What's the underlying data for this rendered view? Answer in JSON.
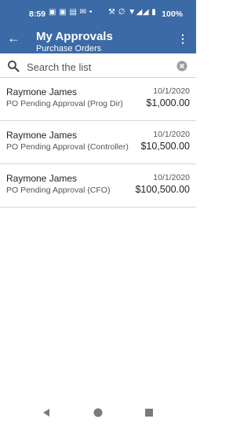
{
  "status_bar": {
    "time": "8:59",
    "battery": "100%",
    "notification_icons": "▣ ▣ ▤ ✉ •",
    "system_icons": "⚒ ∅ ▼◢◢ ▮"
  },
  "app_bar": {
    "title": "My Approvals",
    "subtitle": "Purchase Orders",
    "back_icon": "←",
    "more_icon": "⋮"
  },
  "search": {
    "placeholder": "Search the list",
    "value": ""
  },
  "list": {
    "items": [
      {
        "name": "Raymone James",
        "description": "PO Pending Approval (Prog Dir)",
        "date": "10/1/2020",
        "amount": "$1,000.00"
      },
      {
        "name": "Raymone James",
        "description": "PO Pending Approval (Controller)",
        "date": "10/1/2020",
        "amount": "$10,500.00"
      },
      {
        "name": "Raymone James",
        "description": "PO Pending Approval (CFO)",
        "date": "10/1/2020",
        "amount": "$100,500.00"
      }
    ]
  },
  "colors": {
    "header_background": "#3b6aa6",
    "header_text": "#ffffff",
    "divider": "#d7d7d7"
  }
}
